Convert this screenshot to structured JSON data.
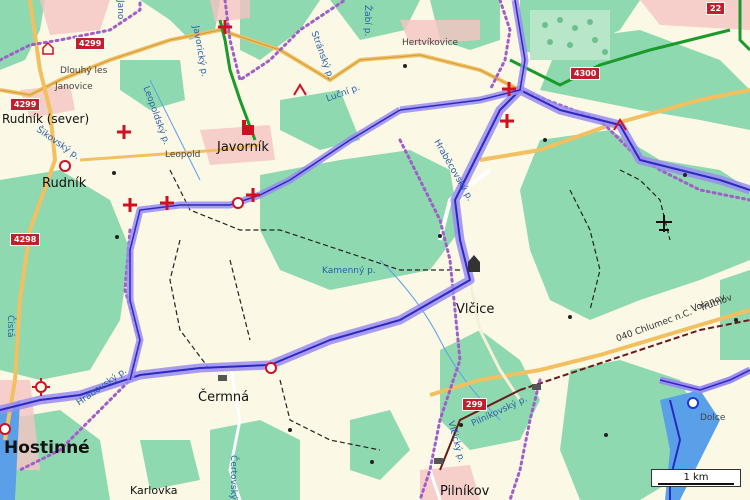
{
  "map": {
    "towns": {
      "javornik": "Javorník",
      "rudnik": "Rudník",
      "rudnik_sever": "Rudník (sever)",
      "vlcice": "Vlčice",
      "cermna": "Čermná",
      "hostinne": "Hostinné",
      "hertvikovice": "Hertvíkovice",
      "janovice": "Janovice",
      "dlouhy_les": "Dlouhý les",
      "leopold": "Leopold",
      "dolce": "Dolce",
      "karlovka": "Karlovka",
      "pilnikov": "Pilníkov"
    },
    "streams": {
      "stransky": "Stránský p.",
      "lucni": "Luční p.",
      "hrabacovsky": "Hraběcovský p.",
      "kamenny": "Kamenný p.",
      "jaworicky": "Javorický p.",
      "leopoldsky": "Leopoldský p.",
      "sikovsky": "Šikovský p.",
      "vlcicky": "Vlčický p.",
      "pilnikovsky": "Pilníkovský p.",
      "zabi": "Žabí p.",
      "jano": "Jano",
      "cista": "Čistá",
      "hrabovsky": "Hrabovský p.",
      "certovsky": "Čertovský"
    },
    "roads": [
      "4299",
      "4299",
      "4298",
      "4300",
      "299",
      "22"
    ],
    "rail_label": "040 Chlumec n.C. - Trutnov",
    "rail_label2": "Volanov",
    "scale": "1 km",
    "colors": {
      "forest": "#8fd9b0",
      "open_land": "#fbf8e6",
      "route_halo": "#9a8cf0",
      "route": "#2a2ac0",
      "border": "#a05fc8",
      "railway": "#6b1a1a",
      "road_red": "#c0202e",
      "road_orange": "#f2c060",
      "green_trail": "#1a9a2a",
      "water": "#2a6fd8"
    }
  }
}
